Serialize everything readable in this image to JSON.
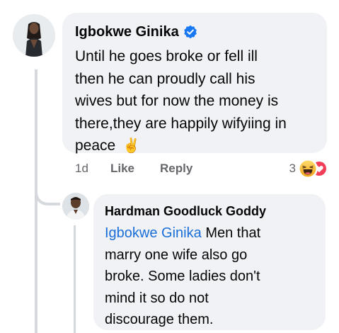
{
  "comment": {
    "author": "Igbokwe Ginika",
    "verified": true,
    "text_lines": [
      "Until he goes broke or fell ill",
      "then he can proudly call his",
      "wives but for now the money is",
      "there,they are happily wifyiing in",
      "peace"
    ],
    "text_emoji": "✌️",
    "actions": {
      "time": "1d",
      "like": "Like",
      "reply": "Reply"
    },
    "reactions": {
      "count": "3",
      "icons": [
        "haha-icon",
        "love-icon"
      ]
    }
  },
  "reply": {
    "author": "Hardman Goodluck Goddy",
    "mention": "Igbokwe Ginika",
    "text_first": "Men that",
    "text_lines": [
      "marry one wife also go",
      "broke. Some ladies don't",
      "mind it so do not",
      "discourage them."
    ]
  },
  "colors": {
    "bubble": "#f0f2f5",
    "mention": "#1a6ed8",
    "verified": "#1877f2",
    "meta": "#65676b"
  }
}
